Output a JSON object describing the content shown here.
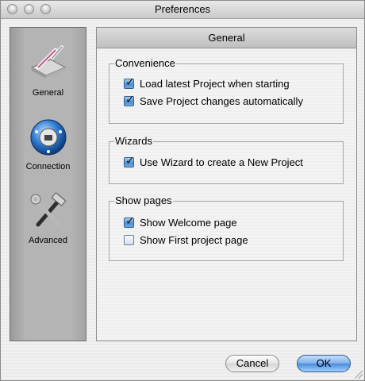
{
  "window": {
    "title": "Preferences"
  },
  "sidebar": {
    "items": [
      {
        "label": "General",
        "icon": "pen-tablet-icon"
      },
      {
        "label": "Connection",
        "icon": "network-globe-icon"
      },
      {
        "label": "Advanced",
        "icon": "hammer-wrench-icon"
      }
    ]
  },
  "panel": {
    "title": "General",
    "groups": [
      {
        "legend": "Convenience",
        "options": [
          {
            "label": "Load latest Project when starting",
            "checked": true
          },
          {
            "label": "Save Project changes automatically",
            "checked": true
          }
        ]
      },
      {
        "legend": "Wizards",
        "options": [
          {
            "label": "Use Wizard to create a New Project",
            "checked": true
          }
        ]
      },
      {
        "legend": "Show pages",
        "options": [
          {
            "label": "Show Welcome page",
            "checked": true
          },
          {
            "label": "Show First project page",
            "checked": false
          }
        ]
      }
    ]
  },
  "buttons": {
    "cancel": "Cancel",
    "ok": "OK"
  },
  "colors": {
    "accent": "#4a8ad9",
    "sidebar": "#b4b4b4"
  }
}
